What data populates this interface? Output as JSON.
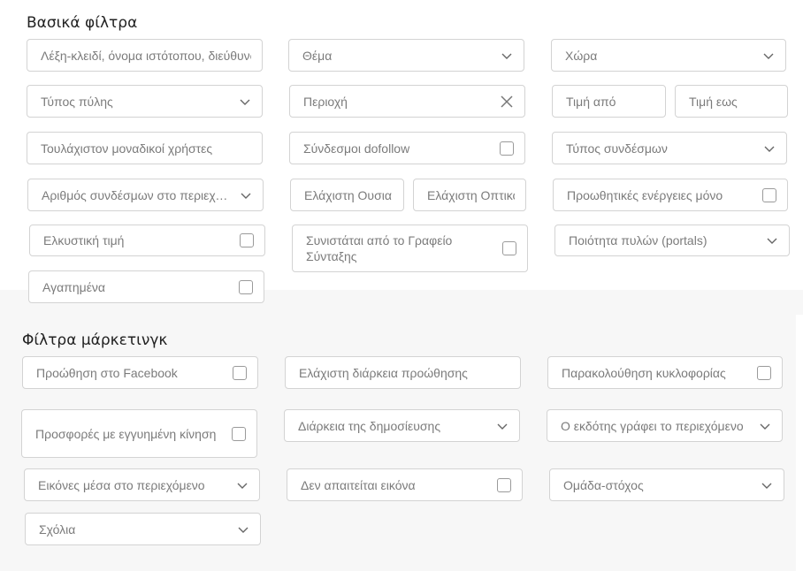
{
  "basic": {
    "title": "Βασικά φίλτρα",
    "keyword_placeholder": "Λέξη-κλειδί, όνομα ιστότοπου, διεύθυνση",
    "topic": "Θέμα",
    "country": "Χώρα",
    "portal_type": "Τύπος πύλης",
    "region": "Περιοχή",
    "price_from": "Τιμή από",
    "price_to": "Τιμή εως",
    "min_unique_users": "Τουλάχιστον μοναδικοί χρήστες",
    "dofollow_links": "Σύνδεσμοι dofollow",
    "link_type": "Τύπος συνδέσμων",
    "links_in_content": "Αριθμός συνδέσμων στο περιεχόμενο",
    "min_substance": "Ελάχιστη Ουσια",
    "min_visibility": "Ελάχιστη Οπτικότητα",
    "promo_only": "Προωθητικές ενέργειες μόνο",
    "attractive_price": "Ελκυστική τιμή",
    "recommended": "Συνιστάται από το Γραφείο Σύνταξης",
    "portal_quality": "Ποιότητα πυλών (portals)",
    "favorites": "Αγαπημένα"
  },
  "marketing": {
    "title": "Φίλτρα μάρκετινγκ",
    "facebook_promo": "Προώθηση στο Facebook",
    "min_promo_duration": "Ελάχιστη διάρκεια προώθησης",
    "traffic_tracking": "Παρακολούθηση κυκλοφορίας",
    "guaranteed_traffic": "Προσφορές με εγγυημένη κίνηση",
    "publication_duration": "Διάρκεια της δημοσίευσης",
    "publisher_writes": "Ο εκδότης γράφει το περιεχόμενο",
    "images_in_content": "Εικόνες μέσα στο περιεχόμενο",
    "no_image_required": "Δεν απαιτείται εικόνα",
    "target_group": "Ομάδα-στόχος",
    "comments": "Σχόλια"
  }
}
